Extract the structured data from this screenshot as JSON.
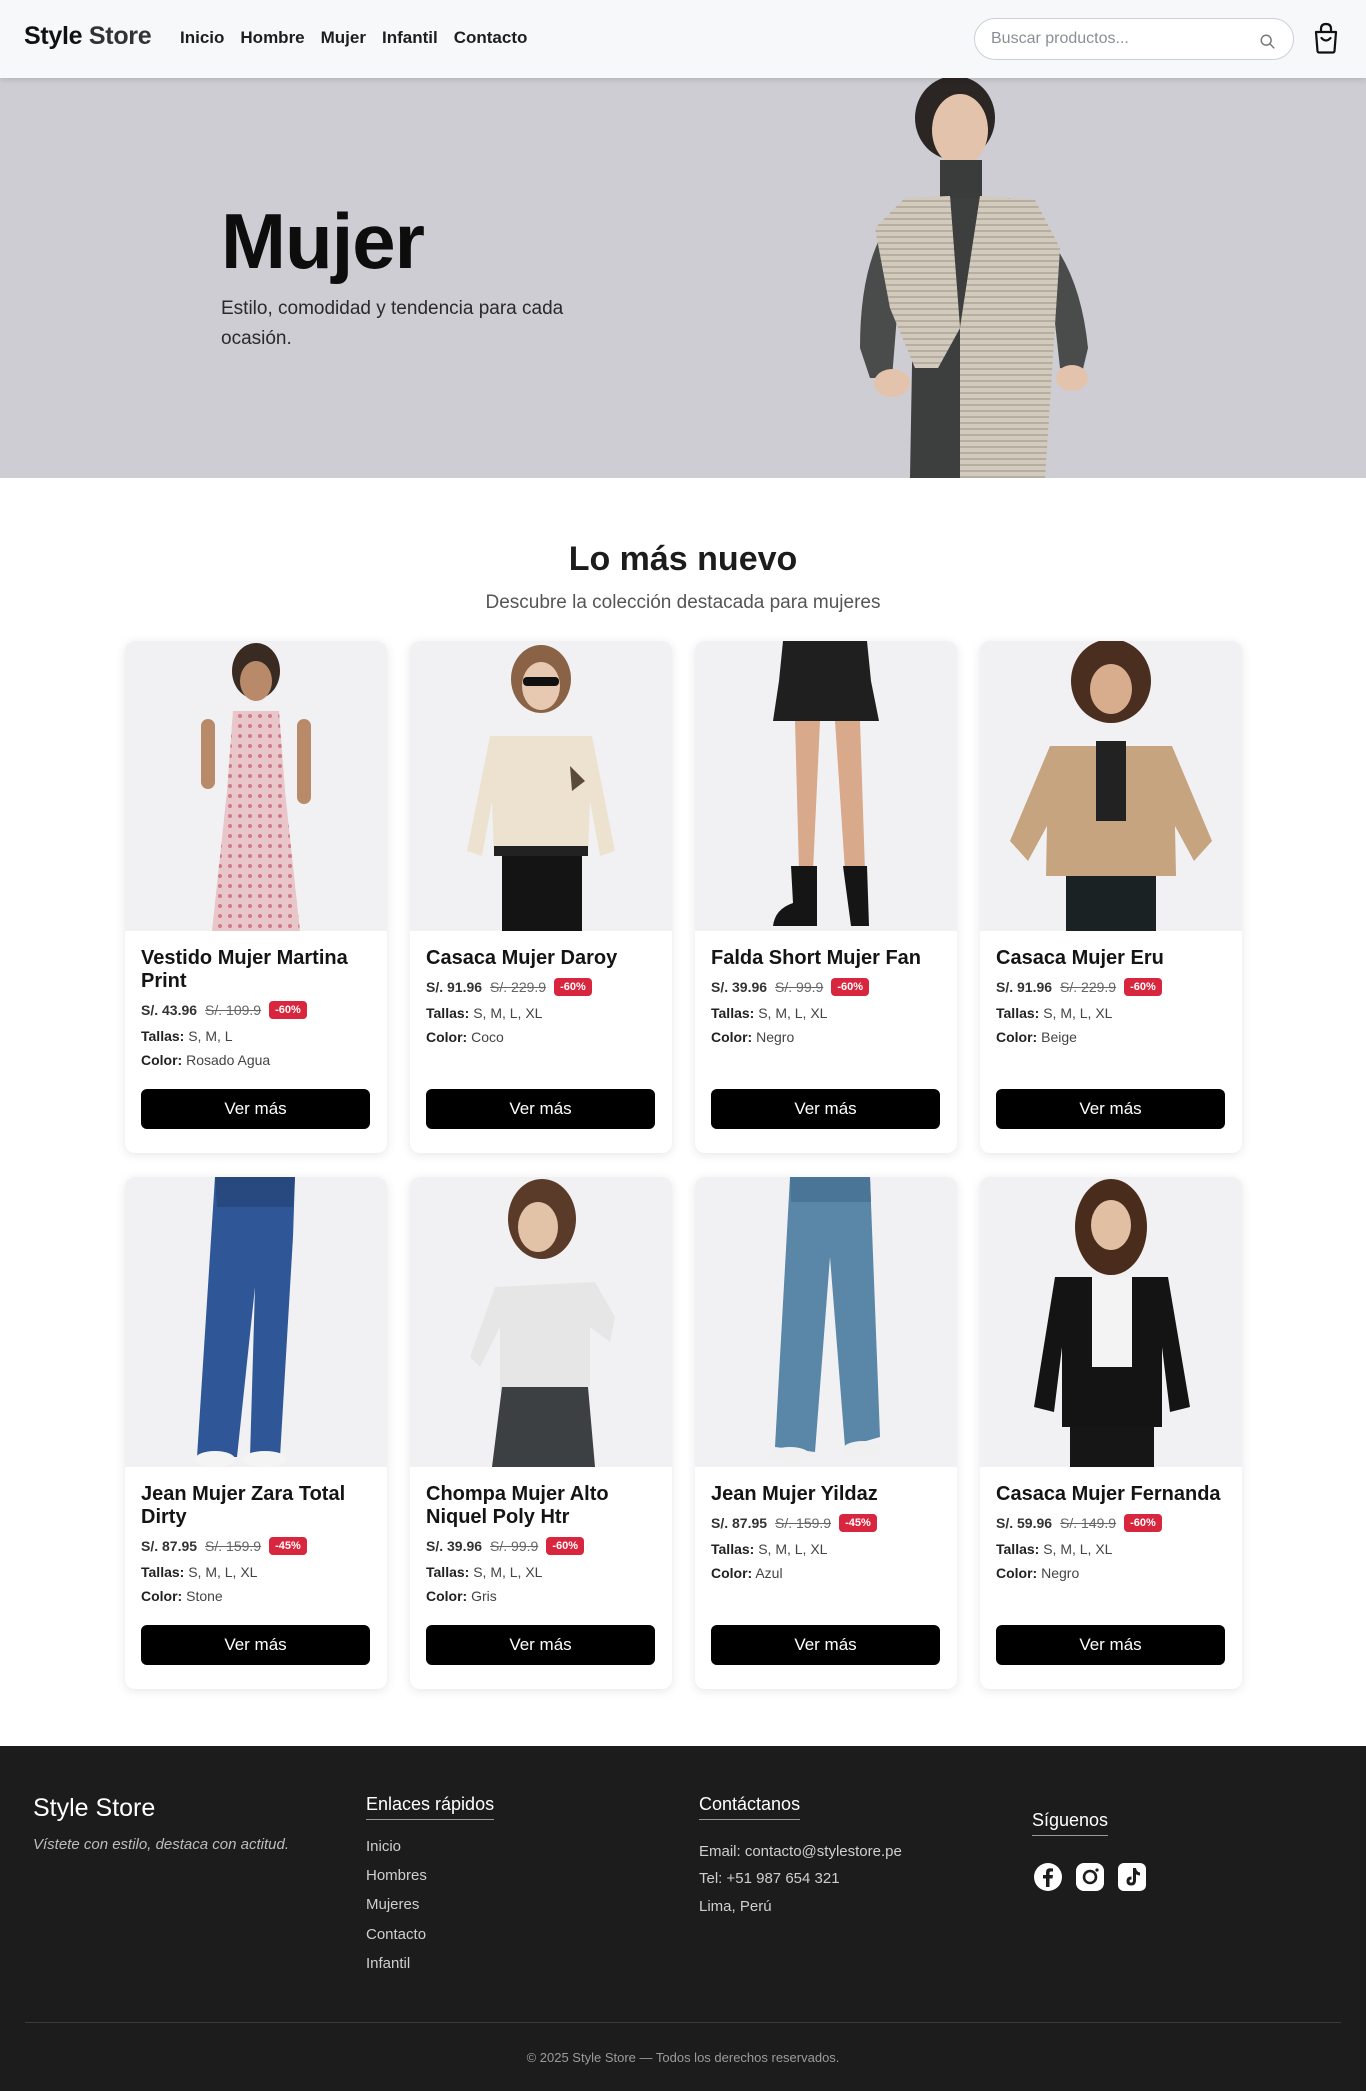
{
  "header": {
    "brand_a": "Style",
    "brand_b": "Store",
    "nav": [
      "Inicio",
      "Hombre",
      "Mujer",
      "Infantil",
      "Contacto"
    ],
    "search_placeholder": "Buscar productos...",
    "icons": {
      "search": "search-icon",
      "cart": "shopping-bag-icon"
    }
  },
  "hero": {
    "title": "Mujer",
    "subtitle": "Estilo, comodidad y tendencia para cada ocasión."
  },
  "section": {
    "title": "Lo más nuevo",
    "subtitle": "Descubre la colección destacada para mujeres"
  },
  "labels": {
    "sizes": "Tallas:",
    "color": "Color:",
    "button": "Ver más"
  },
  "products": [
    {
      "name": "Vestido Mujer Martina Print",
      "price": "S/. 43.96",
      "old_price": "S/. 109.9",
      "discount": "-60%",
      "sizes": "S, M, L",
      "color": "Rosado Agua"
    },
    {
      "name": "Casaca Mujer Daroy",
      "price": "S/. 91.96",
      "old_price": "S/. 229.9",
      "discount": "-60%",
      "sizes": "S, M, L, XL",
      "color": "Coco"
    },
    {
      "name": "Falda Short Mujer Fan",
      "price": "S/. 39.96",
      "old_price": "S/. 99.9",
      "discount": "-60%",
      "sizes": "S, M, L, XL",
      "color": "Negro"
    },
    {
      "name": "Casaca Mujer Eru",
      "price": "S/. 91.96",
      "old_price": "S/. 229.9",
      "discount": "-60%",
      "sizes": "S, M, L, XL",
      "color": "Beige"
    },
    {
      "name": "Jean Mujer Zara Total Dirty",
      "price": "S/. 87.95",
      "old_price": "S/. 159.9",
      "discount": "-45%",
      "sizes": "S, M, L, XL",
      "color": "Stone"
    },
    {
      "name": "Chompa Mujer Alto Niquel Poly Htr",
      "price": "S/. 39.96",
      "old_price": "S/. 99.9",
      "discount": "-60%",
      "sizes": "S, M, L, XL",
      "color": "Gris"
    },
    {
      "name": "Jean Mujer Yildaz",
      "price": "S/. 87.95",
      "old_price": "S/. 159.9",
      "discount": "-45%",
      "sizes": "S, M, L, XL",
      "color": "Azul"
    },
    {
      "name": "Casaca Mujer Fernanda",
      "price": "S/. 59.96",
      "old_price": "S/. 149.9",
      "discount": "-60%",
      "sizes": "S, M, L, XL",
      "color": "Negro"
    }
  ],
  "footer": {
    "brand": "Style Store",
    "tagline": "Vístete con estilo, destaca con actitud.",
    "links_title": "Enlaces rápidos",
    "links": [
      "Inicio",
      "Hombres",
      "Mujeres",
      "Contacto",
      "Infantil"
    ],
    "contact_title": "Contáctanos",
    "email": "Email: contacto@stylestore.pe",
    "phone": "Tel: +51 987 654 321",
    "location": "Lima, Perú",
    "follow_title": "Síguenos",
    "social_icons": [
      "facebook-icon",
      "instagram-icon",
      "tiktok-icon"
    ],
    "copyright": "© 2025 Style Store — Todos los derechos reservados."
  },
  "colors": {
    "discount_badge": "#d7263d",
    "button": "#000000",
    "hero_bg": "#cdcdd3",
    "footer_bg": "#1c1c1c"
  }
}
